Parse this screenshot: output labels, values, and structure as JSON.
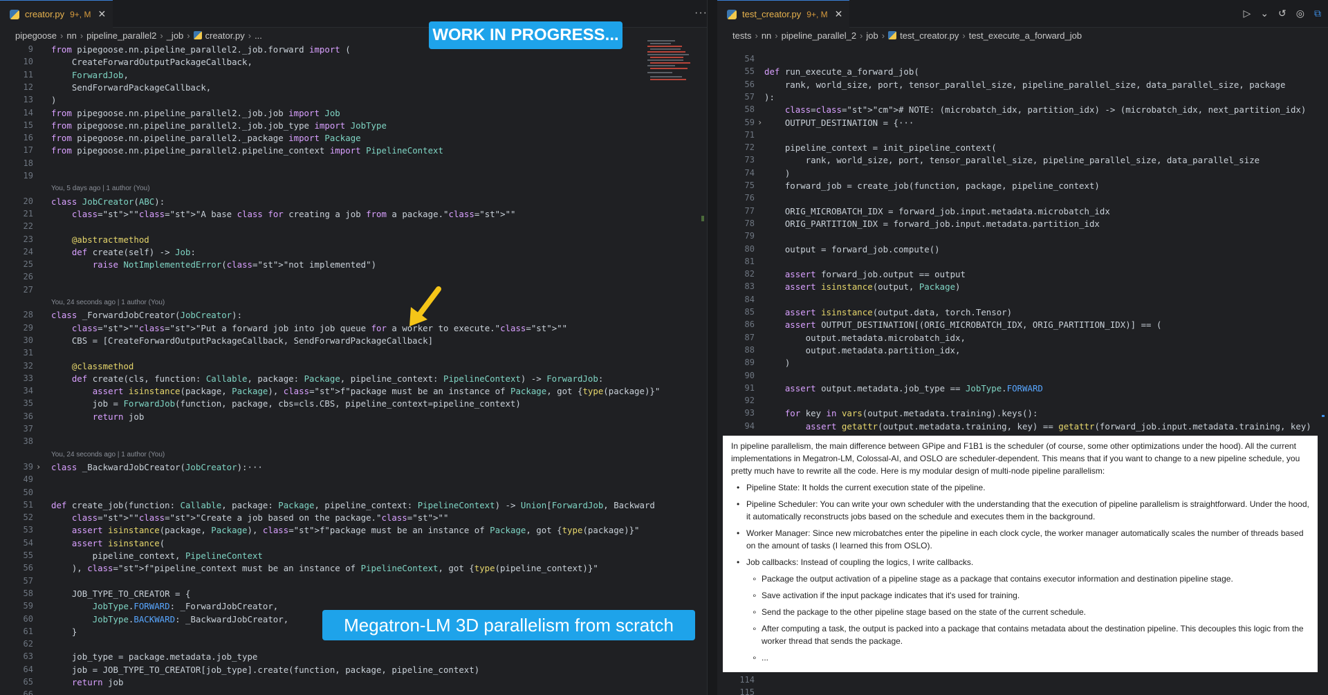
{
  "left": {
    "tab": {
      "filename": "creator.py",
      "status": "9+, M"
    },
    "breadcrumb": [
      "pipegoose",
      "nn",
      "pipeline_parallel2",
      "_job",
      "creator.py",
      "..."
    ],
    "lines": [
      {
        "num": "9",
        "text": "from pipegoose.nn.pipeline_parallel2._job.forward import ("
      },
      {
        "num": "10",
        "text": "    CreateForwardOutputPackageCallback,"
      },
      {
        "num": "11",
        "text": "    ForwardJob,"
      },
      {
        "num": "12",
        "text": "    SendForwardPackageCallback,"
      },
      {
        "num": "13",
        "text": ")"
      },
      {
        "num": "14",
        "text": "from pipegoose.nn.pipeline_parallel2._job.job import Job"
      },
      {
        "num": "15",
        "text": "from pipegoose.nn.pipeline_parallel2._job.job_type import JobType"
      },
      {
        "num": "16",
        "text": "from pipegoose.nn.pipeline_parallel2._package import Package"
      },
      {
        "num": "17",
        "text": "from pipegoose.nn.pipeline_parallel2.pipeline_context import PipelineContext"
      },
      {
        "num": "18",
        "text": ""
      },
      {
        "num": "19",
        "text": ""
      },
      {
        "num": "",
        "text": "You, 5 days ago | 1 author (You)",
        "blame": true
      },
      {
        "num": "20",
        "text": "class JobCreator(ABC):"
      },
      {
        "num": "21",
        "text": "    \"\"\"A base class for creating a job from a package.\"\"\""
      },
      {
        "num": "22",
        "text": ""
      },
      {
        "num": "23",
        "text": "    @abstractmethod"
      },
      {
        "num": "24",
        "text": "    def create(self) -> Job:"
      },
      {
        "num": "25",
        "text": "        raise NotImplementedError(\"not implemented\")"
      },
      {
        "num": "26",
        "text": ""
      },
      {
        "num": "27",
        "text": ""
      },
      {
        "num": "",
        "text": "You, 24 seconds ago | 1 author (You)",
        "blame": true
      },
      {
        "num": "28",
        "text": "class _ForwardJobCreator(JobCreator):"
      },
      {
        "num": "29",
        "text": "    \"\"\"Put a forward job into job queue for a worker to execute.\"\"\""
      },
      {
        "num": "30",
        "text": "    CBS = [CreateForwardOutputPackageCallback, SendForwardPackageCallback]"
      },
      {
        "num": "31",
        "text": ""
      },
      {
        "num": "32",
        "text": "    @classmethod"
      },
      {
        "num": "33",
        "text": "    def create(cls, function: Callable, package: Package, pipeline_context: PipelineContext) -> ForwardJob:"
      },
      {
        "num": "34",
        "text": "        assert isinstance(package, Package), f\"package must be an instance of Package, got {type(package)}\""
      },
      {
        "num": "35",
        "text": "        job = ForwardJob(function, package, cbs=cls.CBS, pipeline_context=pipeline_context)"
      },
      {
        "num": "36",
        "text": "        return job"
      },
      {
        "num": "37",
        "text": ""
      },
      {
        "num": "38",
        "text": ""
      },
      {
        "num": "",
        "text": "You, 24 seconds ago | 1 author (You)",
        "blame": true
      },
      {
        "num": "39",
        "text": "class _BackwardJobCreator(JobCreator):···",
        "fold": true
      },
      {
        "num": "49",
        "text": ""
      },
      {
        "num": "50",
        "text": ""
      },
      {
        "num": "51",
        "text": "def create_job(function: Callable, package: Package, pipeline_context: PipelineContext) -> Union[ForwardJob, Backward"
      },
      {
        "num": "52",
        "text": "    \"\"\"Create a job based on the package.\"\"\""
      },
      {
        "num": "53",
        "text": "    assert isinstance(package, Package), f\"package must be an instance of Package, got {type(package)}\""
      },
      {
        "num": "54",
        "text": "    assert isinstance("
      },
      {
        "num": "55",
        "text": "        pipeline_context, PipelineContext"
      },
      {
        "num": "56",
        "text": "    ), f\"pipeline_context must be an instance of PipelineContext, got {type(pipeline_context)}\""
      },
      {
        "num": "57",
        "text": ""
      },
      {
        "num": "58",
        "text": "    JOB_TYPE_TO_CREATOR = {"
      },
      {
        "num": "59",
        "text": "        JobType.FORWARD: _ForwardJobCreator,"
      },
      {
        "num": "60",
        "text": "        JobType.BACKWARD: _BackwardJobCreator,"
      },
      {
        "num": "61",
        "text": "    }"
      },
      {
        "num": "62",
        "text": ""
      },
      {
        "num": "63",
        "text": "    job_type = package.metadata.job_type"
      },
      {
        "num": "64",
        "text": "    job = JOB_TYPE_TO_CREATOR[job_type].create(function, package, pipeline_context)"
      },
      {
        "num": "65",
        "text": "    return job"
      },
      {
        "num": "66",
        "text": ""
      }
    ]
  },
  "right": {
    "tab": {
      "filename": "test_creator.py",
      "status": "9+, M"
    },
    "breadcrumb": [
      "tests",
      "nn",
      "pipeline_parallel_2",
      "job",
      "test_creator.py",
      "test_execute_a_forward_job"
    ],
    "lines": [
      {
        "num": "54",
        "text": ""
      },
      {
        "num": "55",
        "text": "def run_execute_a_forward_job("
      },
      {
        "num": "56",
        "text": "    rank, world_size, port, tensor_parallel_size, pipeline_parallel_size, data_parallel_size, package"
      },
      {
        "num": "57",
        "text": "):"
      },
      {
        "num": "58",
        "text": "    # NOTE: (microbatch_idx, partition_idx) -> (microbatch_idx, next_partition_idx)"
      },
      {
        "num": "59",
        "text": "    OUTPUT_DESTINATION = {···",
        "fold": true
      },
      {
        "num": "71",
        "text": ""
      },
      {
        "num": "72",
        "text": "    pipeline_context = init_pipeline_context("
      },
      {
        "num": "73",
        "text": "        rank, world_size, port, tensor_parallel_size, pipeline_parallel_size, data_parallel_size"
      },
      {
        "num": "74",
        "text": "    )"
      },
      {
        "num": "75",
        "text": "    forward_job = create_job(function, package, pipeline_context)"
      },
      {
        "num": "76",
        "text": ""
      },
      {
        "num": "77",
        "text": "    ORIG_MICROBATCH_IDX = forward_job.input.metadata.microbatch_idx"
      },
      {
        "num": "78",
        "text": "    ORIG_PARTITION_IDX = forward_job.input.metadata.partition_idx"
      },
      {
        "num": "79",
        "text": ""
      },
      {
        "num": "80",
        "text": "    output = forward_job.compute()"
      },
      {
        "num": "81",
        "text": ""
      },
      {
        "num": "82",
        "text": "    assert forward_job.output == output"
      },
      {
        "num": "83",
        "text": "    assert isinstance(output, Package)"
      },
      {
        "num": "84",
        "text": ""
      },
      {
        "num": "85",
        "text": "    assert isinstance(output.data, torch.Tensor)"
      },
      {
        "num": "86",
        "text": "    assert OUTPUT_DESTINATION[(ORIG_MICROBATCH_IDX, ORIG_PARTITION_IDX)] == ("
      },
      {
        "num": "87",
        "text": "        output.metadata.microbatch_idx,"
      },
      {
        "num": "88",
        "text": "        output.metadata.partition_idx,"
      },
      {
        "num": "89",
        "text": "    )"
      },
      {
        "num": "90",
        "text": ""
      },
      {
        "num": "91",
        "text": "    assert output.metadata.job_type == JobType.FORWARD"
      },
      {
        "num": "92",
        "text": ""
      },
      {
        "num": "93",
        "text": "    for key in vars(output.metadata.training).keys():"
      },
      {
        "num": "94",
        "text": "        assert getattr(output.metadata.training, key) == getattr(forward_job.input.metadata.training, key)"
      }
    ],
    "bottom_lines": [
      {
        "num": "114",
        "text": ""
      },
      {
        "num": "115",
        "text": ""
      }
    ]
  },
  "banners": {
    "wip": "WORK IN PROGRESS...",
    "title": "Megatron-LM 3D parallelism from scratch"
  },
  "note": {
    "intro": "In pipeline parallelism, the main difference between GPipe and F1B1 is the scheduler (of course, some other optimizations under the hood). All the current implementations in Megatron-LM, Colossal-AI, and OSLO are scheduler-dependent. This means that if you want to change to a new pipeline schedule, you pretty much have to rewrite all the code. Here is my modular design of multi-node pipeline parallelism:",
    "bullets": [
      "Pipeline State: It holds the current execution state of the pipeline.",
      "Pipeline Scheduler: You can write your own scheduler with the understanding that the execution of pipeline parallelism is straightforward. Under the hood, it automatically reconstructs jobs based on the schedule and executes them in the background.",
      "Worker Manager: Since new microbatches enter the pipeline in each clock cycle, the worker manager automatically scales the number of threads based on the amount of tasks (I learned this from OSLO).",
      "Job callbacks: Instead of coupling the logics, I write callbacks."
    ],
    "sub_bullets": [
      "Package the output activation of a pipeline stage as a package that contains executor information and destination pipeline stage.",
      "Save activation if the input package indicates that it's used for training.",
      "Send the package to the other pipeline stage based on the state of the current schedule.",
      "After computing a task, the output is packed into a package that contains metadata about the destination pipeline. This decouples this logic from the worker thread that sends the package.",
      "..."
    ]
  },
  "colors": {
    "background": "#1f2023",
    "banner": "#1ea3ea",
    "arrow": "#f5c518",
    "tab_filename": "#e8b34e"
  },
  "icons": {
    "tab_icon": "python-file-icon",
    "run": "run-icon",
    "history": "history-icon",
    "compare": "compare-changes-icon",
    "split": "split-editor-icon"
  }
}
